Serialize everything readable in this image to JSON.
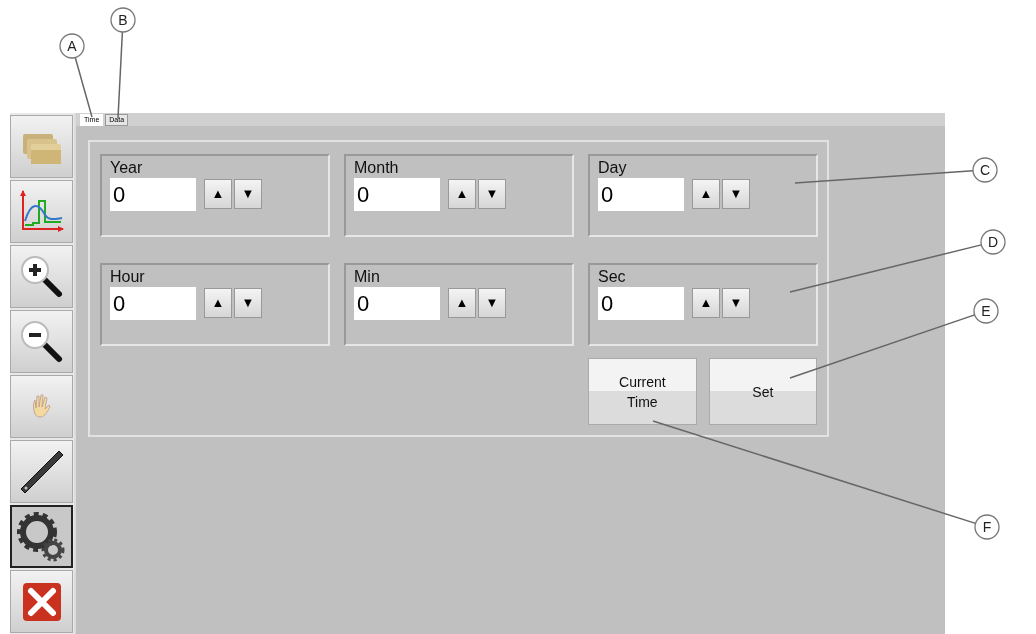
{
  "toolbar": [
    {
      "kind": "folder",
      "selected": false
    },
    {
      "kind": "chart",
      "selected": false
    },
    {
      "kind": "zoom-in",
      "selected": false
    },
    {
      "kind": "zoom-out",
      "selected": false
    },
    {
      "kind": "hand",
      "selected": false
    },
    {
      "kind": "ruler",
      "selected": false
    },
    {
      "kind": "settings",
      "selected": true
    },
    {
      "kind": "close",
      "selected": false
    }
  ],
  "tabs": [
    {
      "label": "Time",
      "selected": true
    },
    {
      "label": "Data",
      "selected": false
    }
  ],
  "fields": [
    {
      "label": "Year",
      "value": "0",
      "up": "▲",
      "down": "▼"
    },
    {
      "label": "Month",
      "value": "0",
      "up": "▲",
      "down": "▼"
    },
    {
      "label": "Day",
      "value": "0",
      "up": "▲",
      "down": "▼"
    },
    {
      "label": "Hour",
      "value": "0",
      "up": "▲",
      "down": "▼"
    },
    {
      "label": "Min",
      "value": "0",
      "up": "▲",
      "down": "▼"
    },
    {
      "label": "Sec",
      "value": "0",
      "up": "▲",
      "down": "▼"
    }
  ],
  "buttons": [
    "Current Time",
    "Set"
  ],
  "callouts": [
    "A",
    "B",
    "C",
    "D",
    "E",
    "F"
  ]
}
